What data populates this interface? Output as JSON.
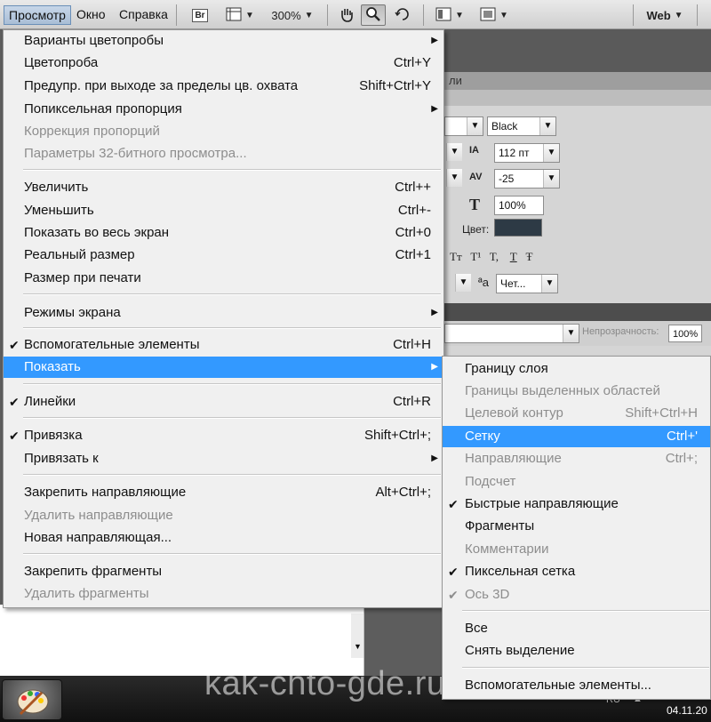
{
  "menubar": {
    "items": [
      "Просмотр",
      "Окно",
      "Справка"
    ],
    "bridge": "Br",
    "zoom": "300%",
    "workspace": "Web"
  },
  "panel": {
    "tab_partial": "ли",
    "font_style": "Black",
    "font_size": "112 пт",
    "tracking": "-25",
    "vscale": "100%",
    "color_label": "Цвет:",
    "color_swatch": "#2d3a45",
    "style_buttons": [
      "Tт",
      "T¹",
      "T,",
      "T",
      "Ŧ"
    ],
    "aa_label": "ªa",
    "aa_value": "Чет...",
    "opacity_label": "Непрозрачность:",
    "opacity_value": "100%"
  },
  "view_menu": {
    "items": [
      {
        "label": "Варианты цветопробы",
        "shortcut": "",
        "submenu": true,
        "disabled": false,
        "checked": false
      },
      {
        "label": "Цветопроба",
        "shortcut": "Ctrl+Y",
        "submenu": false,
        "disabled": false,
        "checked": false
      },
      {
        "label": "Предупр. при выходе за пределы цв. охвата",
        "shortcut": "Shift+Ctrl+Y",
        "submenu": false,
        "disabled": false,
        "checked": false
      },
      {
        "label": "Попиксельная пропорция",
        "shortcut": "",
        "submenu": true,
        "disabled": false,
        "checked": false
      },
      {
        "label": "Коррекция пропорций",
        "shortcut": "",
        "submenu": false,
        "disabled": true,
        "checked": false
      },
      {
        "label": "Параметры 32-битного просмотра...",
        "shortcut": "",
        "submenu": false,
        "disabled": true,
        "checked": false
      },
      {
        "label": "Увеличить",
        "shortcut": "Ctrl++",
        "submenu": false,
        "disabled": false,
        "checked": false
      },
      {
        "label": "Уменьшить",
        "shortcut": "Ctrl+-",
        "submenu": false,
        "disabled": false,
        "checked": false
      },
      {
        "label": "Показать во весь экран",
        "shortcut": "Ctrl+0",
        "submenu": false,
        "disabled": false,
        "checked": false
      },
      {
        "label": "Реальный размер",
        "shortcut": "Ctrl+1",
        "submenu": false,
        "disabled": false,
        "checked": false
      },
      {
        "label": "Размер при печати",
        "shortcut": "",
        "submenu": false,
        "disabled": false,
        "checked": false
      },
      {
        "label": "Режимы экрана",
        "shortcut": "",
        "submenu": true,
        "disabled": false,
        "checked": false
      },
      {
        "label": "Вспомогательные элементы",
        "shortcut": "Ctrl+H",
        "submenu": false,
        "disabled": false,
        "checked": true
      },
      {
        "label": "Показать",
        "shortcut": "",
        "submenu": true,
        "disabled": false,
        "checked": false,
        "highlighted": true
      },
      {
        "label": "Линейки",
        "shortcut": "Ctrl+R",
        "submenu": false,
        "disabled": false,
        "checked": true
      },
      {
        "label": "Привязка",
        "shortcut": "Shift+Ctrl+;",
        "submenu": false,
        "disabled": false,
        "checked": true
      },
      {
        "label": "Привязать к",
        "shortcut": "",
        "submenu": true,
        "disabled": false,
        "checked": false
      },
      {
        "label": "Закрепить направляющие",
        "shortcut": "Alt+Ctrl+;",
        "submenu": false,
        "disabled": false,
        "checked": false
      },
      {
        "label": "Удалить направляющие",
        "shortcut": "",
        "submenu": false,
        "disabled": true,
        "checked": false
      },
      {
        "label": "Новая направляющая...",
        "shortcut": "",
        "submenu": false,
        "disabled": false,
        "checked": false
      },
      {
        "label": "Закрепить фрагменты",
        "shortcut": "",
        "submenu": false,
        "disabled": false,
        "checked": false
      },
      {
        "label": "Удалить фрагменты",
        "shortcut": "",
        "submenu": false,
        "disabled": true,
        "checked": false
      }
    ]
  },
  "show_submenu": {
    "items": [
      {
        "label": "Границу слоя",
        "shortcut": "",
        "disabled": false,
        "checked": false
      },
      {
        "label": "Границы выделенных областей",
        "shortcut": "",
        "disabled": true,
        "checked": false
      },
      {
        "label": "Целевой контур",
        "shortcut": "Shift+Ctrl+H",
        "disabled": true,
        "checked": false
      },
      {
        "label": "Сетку",
        "shortcut": "Ctrl+'",
        "disabled": false,
        "checked": false,
        "highlighted": true
      },
      {
        "label": "Направляющие",
        "shortcut": "Ctrl+;",
        "disabled": true,
        "checked": false
      },
      {
        "label": "Подсчет",
        "shortcut": "",
        "disabled": true,
        "checked": false
      },
      {
        "label": "Быстрые направляющие",
        "shortcut": "",
        "disabled": false,
        "checked": true
      },
      {
        "label": "Фрагменты",
        "shortcut": "",
        "disabled": false,
        "checked": false
      },
      {
        "label": "Комментарии",
        "shortcut": "",
        "disabled": true,
        "checked": false
      },
      {
        "label": "Пиксельная сетка",
        "shortcut": "",
        "disabled": false,
        "checked": true
      },
      {
        "label": "Ось 3D",
        "shortcut": "",
        "disabled": true,
        "checked": true
      },
      {
        "label": "Все",
        "shortcut": "",
        "disabled": false,
        "checked": false
      },
      {
        "label": "Снять выделение",
        "shortcut": "",
        "disabled": false,
        "checked": false
      },
      {
        "label": "Вспомогательные элементы...",
        "shortcut": "",
        "disabled": false,
        "checked": false
      }
    ]
  },
  "taskbar": {
    "watermark": "kak-chto-gde.ru",
    "lang": "RU",
    "clock": "04.11.20"
  }
}
